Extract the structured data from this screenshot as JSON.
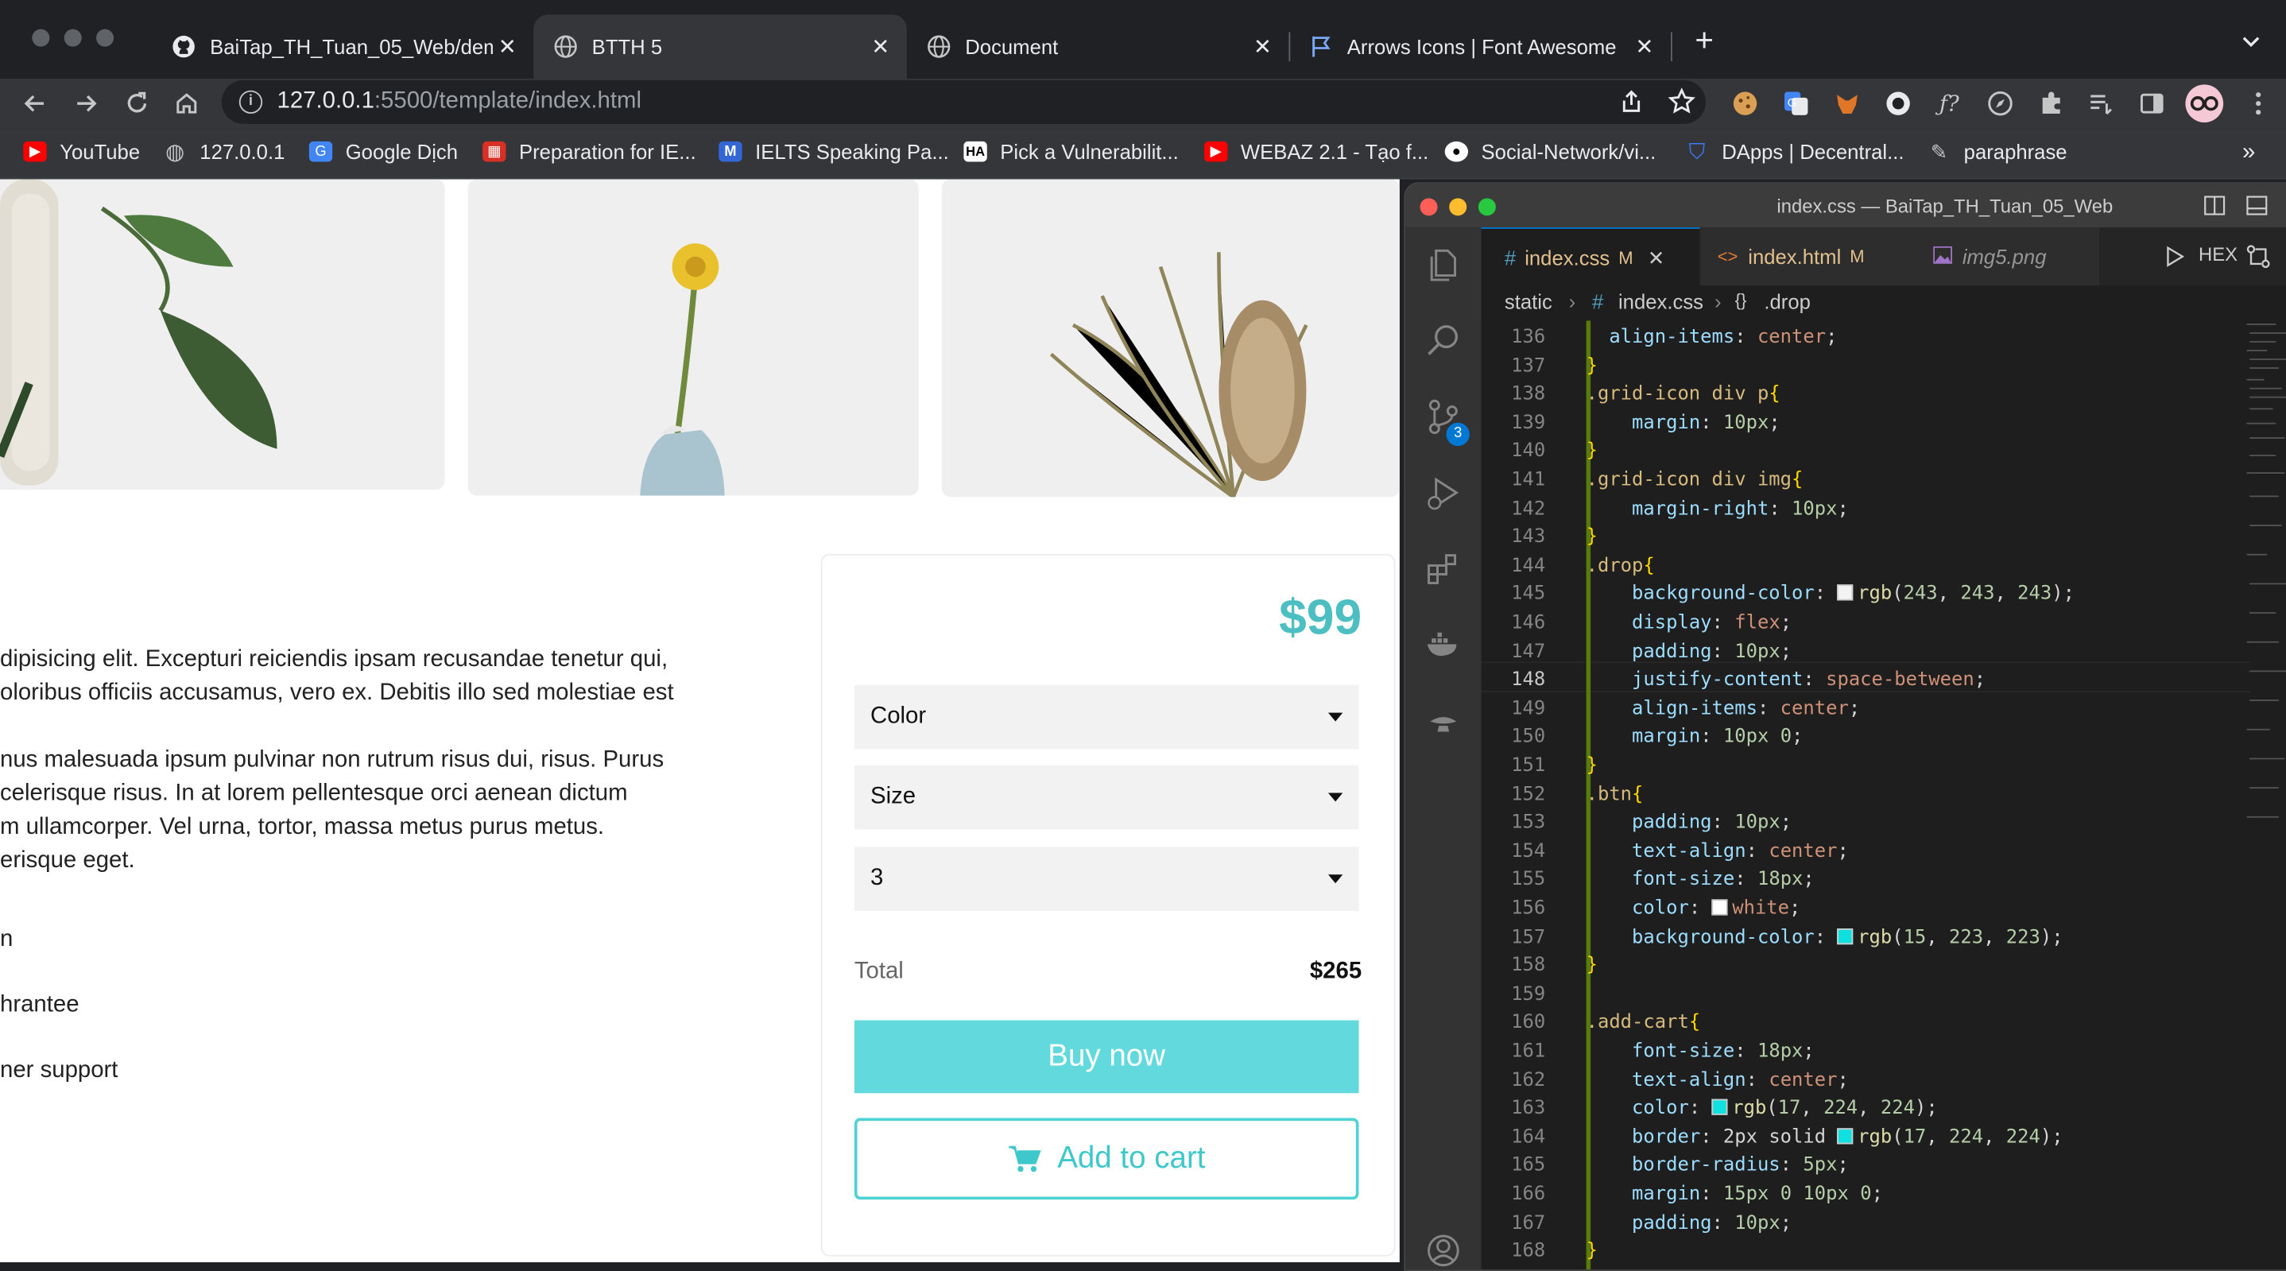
{
  "browser": {
    "tabs": [
      {
        "title": "BaiTap_TH_Tuan_05_Web/dem",
        "icon": "github-icon",
        "active": false
      },
      {
        "title": "BTTH 5",
        "icon": "globe-icon",
        "active": true
      },
      {
        "title": "Document",
        "icon": "globe-icon",
        "active": false
      },
      {
        "title": "Arrows Icons | Font Awesome",
        "icon": "flag-icon",
        "active": false
      }
    ],
    "new_tab": "+",
    "tab_close": "✕",
    "url_host": "127.0.0.1",
    "url_rest": ":5500/template/index.html",
    "bookmarks": [
      {
        "label": "YouTube",
        "icon": "youtube-icon",
        "color": "#ff0000"
      },
      {
        "label": "127.0.0.1",
        "icon": "globe-icon",
        "color": "#5f6368"
      },
      {
        "label": "Google Dịch",
        "icon": "google-translate-icon",
        "color": "#4285f4"
      },
      {
        "label": "Preparation for IE...",
        "icon": "grid-icon",
        "color": "#d93025"
      },
      {
        "label": "IELTS Speaking Pa...",
        "icon": "m-logo-icon",
        "color": "#3367d6"
      },
      {
        "label": "Pick a Vulnerabilit...",
        "icon": "ha-logo-icon",
        "color": "#ffffff"
      },
      {
        "label": "WEBAZ 2.1 - Tạo f...",
        "icon": "youtube-icon",
        "color": "#ff0000"
      },
      {
        "label": "Social-Network/vi...",
        "icon": "github-icon",
        "color": "#ffffff"
      },
      {
        "label": "DApps | Decentral...",
        "icon": "shield-icon",
        "color": "#3c7bf6"
      },
      {
        "label": "paraphrase",
        "icon": "feather-icon",
        "color": "#c4c7c5"
      }
    ],
    "more_bookmarks": "»"
  },
  "product": {
    "description_lines": [
      "dipisicing elit. Excepturi reiciendis ipsam recusandae tenetur qui,",
      "oloribus officiis accusamus, vero ex. Debitis illo sed molestiae est",
      "nus malesuada ipsum pulvinar non rutrum risus dui, risus. Purus",
      "celerisque risus. In at lorem pellentesque orci aenean dictum",
      "m ullamcorper. Vel urna, tortor, massa metus purus metus.",
      "erisque eget."
    ],
    "features": [
      "n",
      "hrantee",
      "ner support"
    ],
    "price": "$99",
    "color_select": "Color",
    "size_select": "Size",
    "quantity_select": "3",
    "total_label": "Total",
    "total_value": "$265",
    "buy_now": "Buy now",
    "add_to_cart": "Add to cart",
    "accent_color": "#62dadd"
  },
  "vscode": {
    "window_title": "index.css — BaiTap_TH_Tuan_05_Web",
    "tabs": [
      {
        "name": "index.css",
        "status": "M",
        "icon": "#",
        "active": true
      },
      {
        "name": "index.html",
        "status": "M",
        "icon": "<>",
        "active": false
      },
      {
        "name": "img5.png",
        "status": "",
        "icon": "image-icon",
        "active": false
      }
    ],
    "hex_label": "HEX",
    "breadcrumb": [
      "static",
      "index.css",
      ".drop"
    ],
    "scm_badge": "3",
    "line_numbers": [
      "136",
      "137",
      "138",
      "139",
      "140",
      "141",
      "142",
      "143",
      "144",
      "145",
      "146",
      "147",
      "148",
      "149",
      "150",
      "151",
      "152",
      "153",
      "154",
      "155",
      "156",
      "157",
      "158",
      "159",
      "160",
      "161",
      "162",
      "163",
      "164",
      "165",
      "166",
      "167",
      "168"
    ],
    "code_lines": [
      "  align-items: center;",
      "}",
      ".grid-icon div p{",
      "    margin: 10px;",
      "}",
      ".grid-icon div img{",
      "    margin-right: 10px;",
      "}",
      ".drop{",
      "    background-color: rgb(243, 243, 243);",
      "    display: flex;",
      "    padding: 10px;",
      "    justify-content: space-between;",
      "    align-items: center;",
      "    margin: 10px 0;",
      "}",
      ".btn{",
      "    padding: 10px;",
      "    text-align: center;",
      "    font-size: 18px;",
      "    color: white;",
      "    background-color: rgb(15, 223, 223);",
      "}",
      "",
      ".add-cart{",
      "    font-size: 18px;",
      "    text-align: center;",
      "    color: rgb(17, 224, 224);",
      "    border: 2px solid rgb(17, 224, 224);",
      "    border-radius: 5px;",
      "    margin: 15px 0 10px 0;",
      "    padding: 10px;",
      "}"
    ]
  }
}
